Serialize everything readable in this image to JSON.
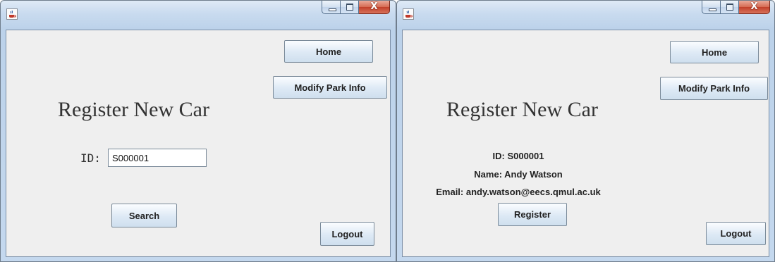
{
  "left_window": {
    "controls": {
      "min": "minimize-icon",
      "max": "maximize-icon",
      "close": "X"
    },
    "buttons": {
      "home": "Home",
      "modify": "Modify Park Info",
      "search": "Search",
      "logout": "Logout"
    },
    "heading": "Register New Car",
    "id_label": "ID:",
    "id_value": "S000001"
  },
  "right_window": {
    "controls": {
      "min": "minimize-icon",
      "max": "maximize-icon",
      "close": "X"
    },
    "buttons": {
      "home": "Home",
      "modify": "Modify Park Info",
      "register": "Register",
      "logout": "Logout"
    },
    "heading": "Register New Car",
    "id_line": "ID: S000001",
    "name_line": "Name: Andy Watson",
    "email_line": "Email: andy.watson@eecs.qmul.ac.uk"
  },
  "icons": {
    "app": "java-cup-icon"
  }
}
